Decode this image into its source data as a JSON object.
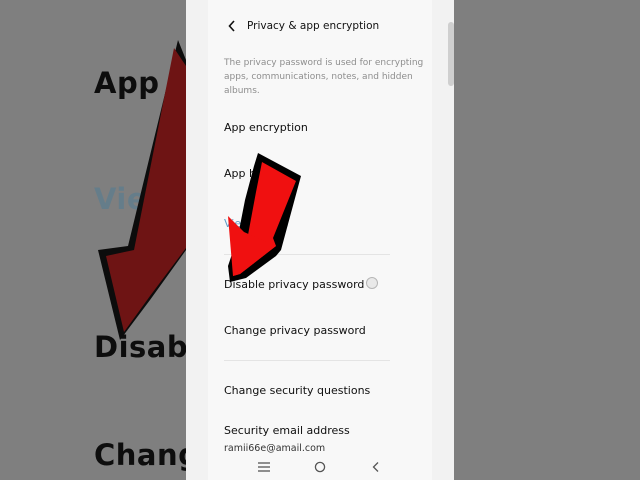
{
  "backdrop": {
    "left_lines": [
      "App h",
      "View",
      "Disable",
      "Change"
    ]
  },
  "header": {
    "back_icon": "chevron-left-icon",
    "title": "Privacy & app encryption"
  },
  "description": "The privacy password is used for encrypting apps, communications, notes, and hidden albums.",
  "items": {
    "app_encryption": "App encryption",
    "app_hidden": "App h",
    "view_hidden_apps": "Vie    en apps",
    "disable_privacy_password": "Disable privacy password",
    "change_privacy_password": "Change privacy password",
    "change_security_questions": "Change security questions",
    "security_email": "Security email address",
    "email_value": "ramii66e@amail.com"
  },
  "nav": {
    "menu_icon": "menu-icon",
    "home_icon": "home-circle-icon",
    "back_icon": "back-triangle-icon"
  },
  "colors": {
    "arrow_red": "#f01010",
    "link_blue": "#5f9cc7"
  }
}
